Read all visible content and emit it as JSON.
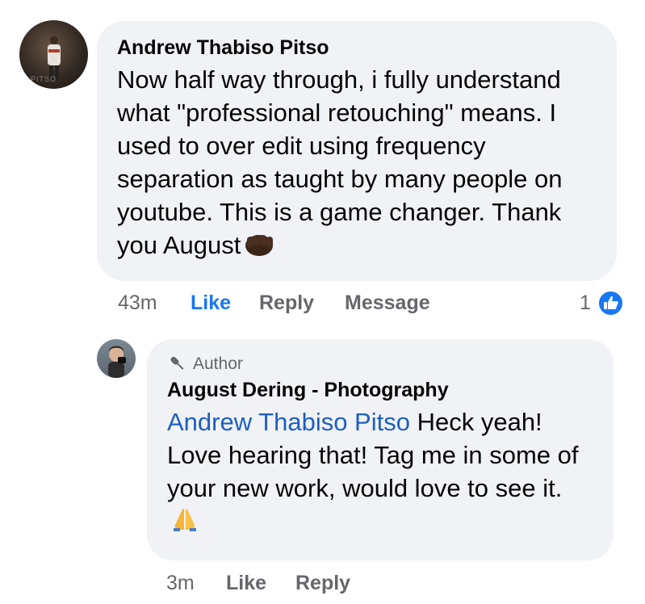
{
  "comment": {
    "author": "Andrew Thabiso Pitso",
    "avatar_text": "PITSO",
    "text": "Now half way through, i fully understand what \"professional retouching\" means. I used to over edit using frequency separation as taught by many people on youtube. This is a game changer. Thank you August",
    "emoji": "fist-bump-emoji",
    "time": "43m",
    "like_label": "Like",
    "reply_label": "Reply",
    "message_label": "Message",
    "reaction_count": "1",
    "reaction_icon": "like-thumb-icon",
    "colors": {
      "like": "#1877f2",
      "meta": "#65676b",
      "bubble": "#f0f2f5"
    }
  },
  "reply": {
    "badge_label": "Author",
    "badge_icon": "microphone-icon",
    "author": "August Dering - Photography",
    "mention": "Andrew Thabiso Pitso",
    "text": " Heck yeah! Love hearing that! Tag me in some of your new work, would love to see it.",
    "emoji": "folded-hands-emoji",
    "time": "3m",
    "like_label": "Like",
    "reply_label": "Reply",
    "mention_color": "#1d5fbf"
  }
}
